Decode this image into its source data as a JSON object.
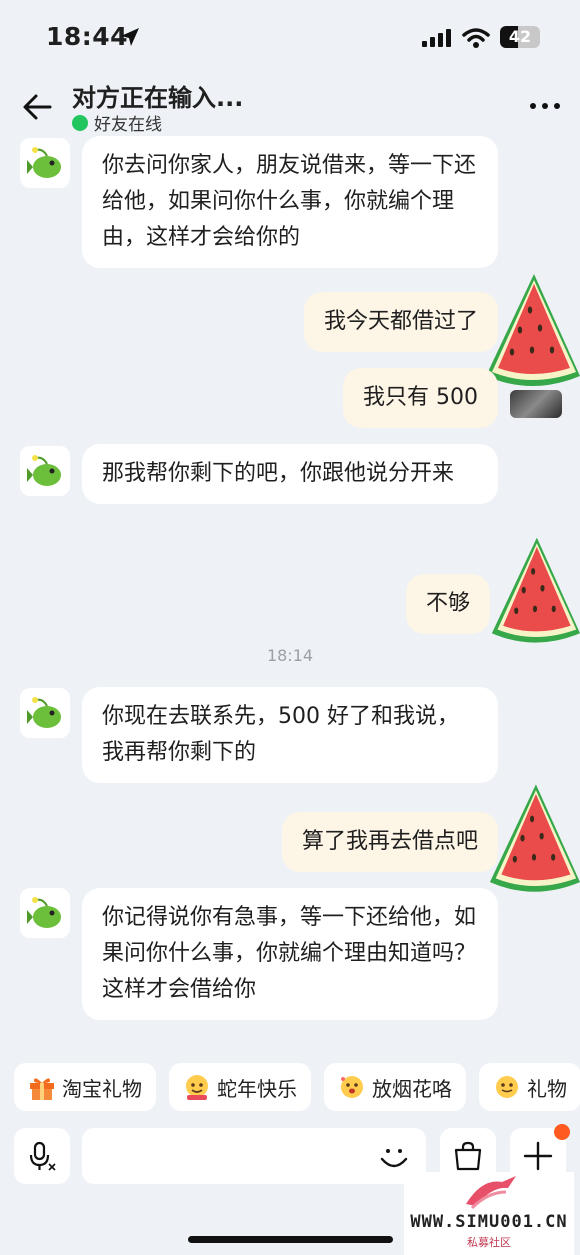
{
  "status_bar": {
    "time": "18:44",
    "battery": "42"
  },
  "header": {
    "title": "对方正在输入...",
    "presence": "好友在线"
  },
  "messages": [
    {
      "text": "你去问你家人，朋友说借来，等一下还给他，如果问你什么事，你就编个理由，这样才会给你的"
    },
    {
      "text": "我今天都借过了"
    },
    {
      "text": "我只有 500"
    },
    {
      "text": "那我帮你剩下的吧，你跟他说分开来"
    },
    {
      "text": "不够"
    },
    {
      "text": "你现在去联系先，500 好了和我说，我再帮你剩下的"
    },
    {
      "text": "算了我再去借点吧"
    },
    {
      "text": "你记得说你有急事，等一下还给他，如果问你什么事，你就编个理由知道吗？这样才会借给你"
    }
  ],
  "timestamp": "18:14",
  "quick_chips": [
    {
      "label": "淘宝礼物",
      "icon": "gift-icon"
    },
    {
      "label": "蛇年快乐",
      "icon": "emoji-face-icon"
    },
    {
      "label": "放烟花咯",
      "icon": "emoji-face-icon"
    },
    {
      "label": "礼物",
      "icon": "emoji-face-icon"
    }
  ],
  "watermark": {
    "url": "WWW.SIMU001.CN",
    "sub": "私募社区"
  }
}
